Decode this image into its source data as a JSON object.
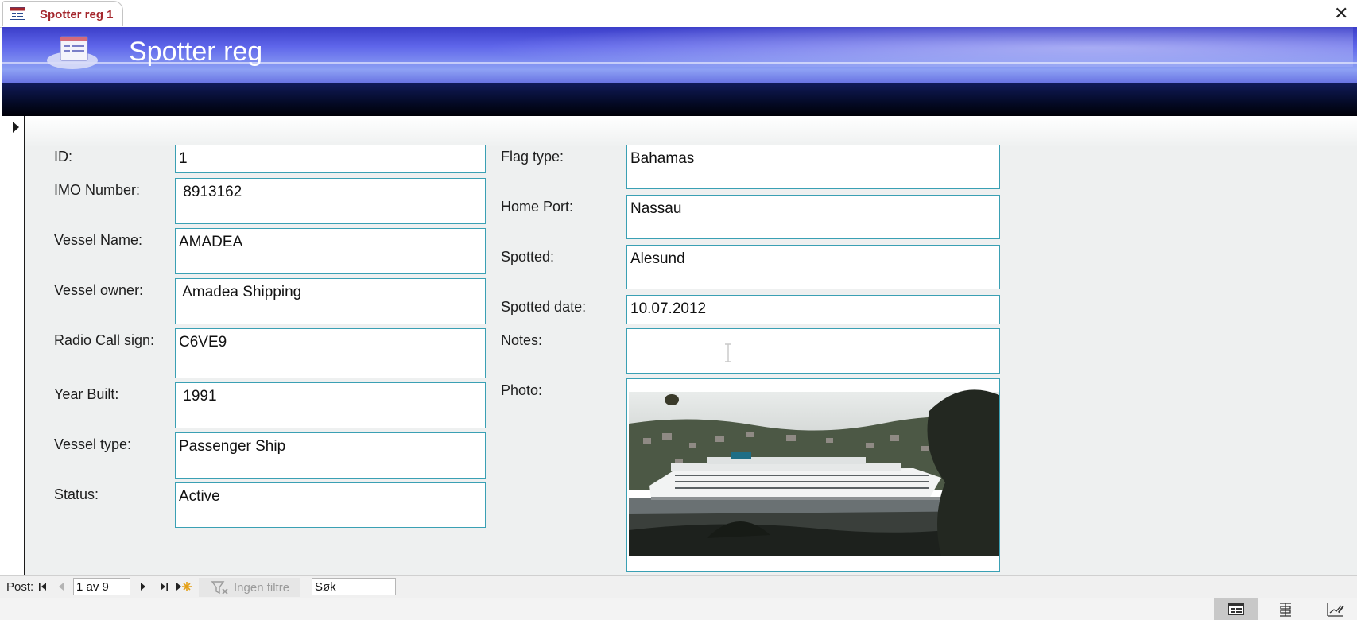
{
  "tab": {
    "title": "Spotter reg 1",
    "icon": "form-icon"
  },
  "window": {
    "close_glyph": "✕"
  },
  "header": {
    "title": "Spotter reg",
    "icon": "form-icon",
    "colors": {
      "band": "#5f66ea",
      "dark": "#040a26"
    }
  },
  "fields_left": [
    {
      "label": "ID:",
      "value": "1"
    },
    {
      "label": "IMO Number:",
      "value": " 8913162"
    },
    {
      "label": "Vessel Name:",
      "value": "AMADEA"
    },
    {
      "label": "Vessel owner:",
      "value": " Amadea Shipping"
    },
    {
      "label": "Radio Call sign:",
      "value": "C6VE9"
    },
    {
      "label": "Year Built:",
      "value": " 1991"
    },
    {
      "label": "Vessel type:",
      "value": "Passenger Ship"
    },
    {
      "label": "Status:",
      "value": "Active"
    }
  ],
  "fields_right": [
    {
      "label": "Flag type:",
      "value": "Bahamas"
    },
    {
      "label": "Home Port:",
      "value": "Nassau"
    },
    {
      "label": "Spotted:",
      "value": "Alesund"
    },
    {
      "label": "Spotted date:",
      "value": "10.07.2012"
    },
    {
      "label": "Notes:",
      "value": ""
    }
  ],
  "photo": {
    "label": "Photo:",
    "subject": "cruise ship photo"
  },
  "navigation": {
    "post_label": "Post:",
    "record_text": "1 av 9",
    "filter_text": "Ingen filtre",
    "search_text": "Søk"
  },
  "status_views": [
    "form-view-icon",
    "layout-view-icon",
    "design-view-icon"
  ]
}
